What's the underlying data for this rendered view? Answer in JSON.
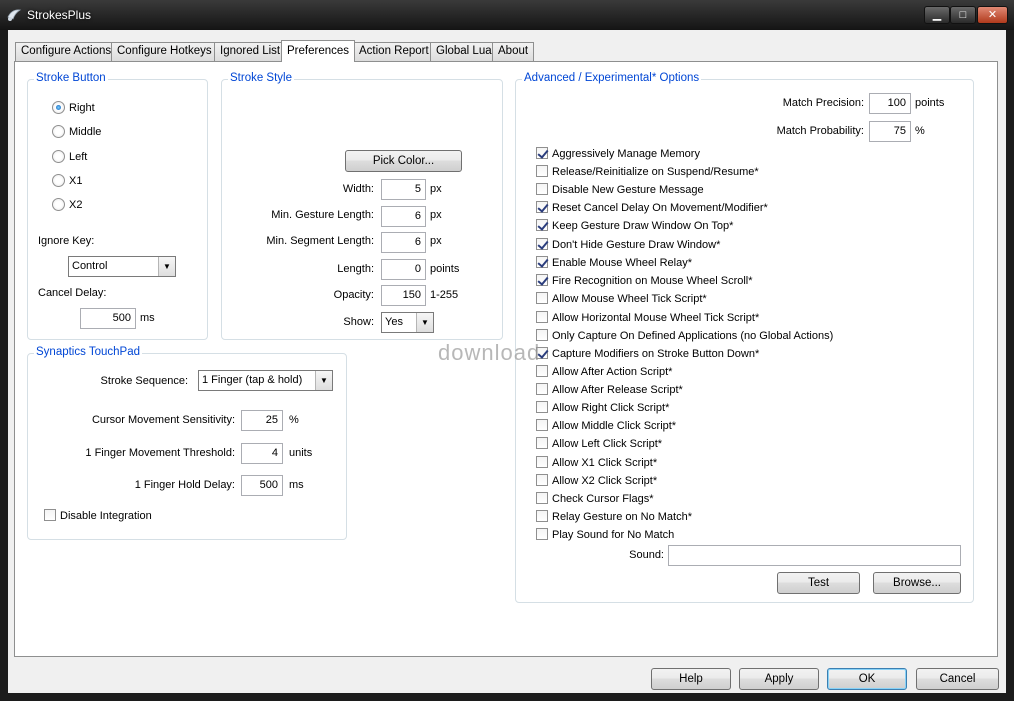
{
  "window": {
    "title": "StrokesPlus",
    "min_glyph": "▁",
    "max_glyph": "□",
    "close_glyph": "✕"
  },
  "tabs": [
    "Configure Actions",
    "Configure Hotkeys",
    "Ignored List",
    "Preferences",
    "Action Report",
    "Global Lua",
    "About"
  ],
  "stroke_button": {
    "title": "Stroke Button",
    "options": [
      "Right",
      "Middle",
      "Left",
      "X1",
      "X2"
    ],
    "selected": "Right",
    "ignore_key_label": "Ignore Key:",
    "ignore_key_value": "Control",
    "cancel_delay_label": "Cancel Delay:",
    "cancel_delay_value": "500",
    "cancel_delay_unit": "ms"
  },
  "stroke_style": {
    "title": "Stroke Style",
    "pick_color_label": "Pick Color...",
    "width_label": "Width:",
    "width_value": "5",
    "width_unit": "px",
    "min_gesture_label": "Min. Gesture Length:",
    "min_gesture_value": "6",
    "min_gesture_unit": "px",
    "min_segment_label": "Min. Segment Length:",
    "min_segment_value": "6",
    "min_segment_unit": "px",
    "length_label": "Length:",
    "length_value": "0",
    "length_unit": "points",
    "opacity_label": "Opacity:",
    "opacity_value": "150",
    "opacity_unit": "1-255",
    "show_label": "Show:",
    "show_value": "Yes"
  },
  "touchpad": {
    "title": "Synaptics TouchPad",
    "stroke_sequence_label": "Stroke Sequence:",
    "stroke_sequence_value": "1 Finger (tap & hold)",
    "sensitivity_label": "Cursor Movement Sensitivity:",
    "sensitivity_value": "25",
    "sensitivity_unit": "%",
    "threshold_label": "1 Finger Movement Threshold:",
    "threshold_value": "4",
    "threshold_unit": "units",
    "hold_delay_label": "1 Finger Hold Delay:",
    "hold_delay_value": "500",
    "hold_delay_unit": "ms",
    "disable_integration_label": "Disable Integration"
  },
  "advanced": {
    "title": "Advanced / Experimental* Options",
    "match_precision_label": "Match Precision:",
    "match_precision_value": "100",
    "match_precision_unit": "points",
    "match_probability_label": "Match Probability:",
    "match_probability_value": "75",
    "match_probability_unit": "%",
    "options": [
      {
        "label": "Aggressively Manage Memory",
        "checked": true
      },
      {
        "label": "Release/Reinitialize on Suspend/Resume*",
        "checked": false
      },
      {
        "label": "Disable New Gesture Message",
        "checked": false
      },
      {
        "label": "Reset Cancel Delay On Movement/Modifier*",
        "checked": true
      },
      {
        "label": "Keep Gesture Draw Window On Top*",
        "checked": true
      },
      {
        "label": "Don't Hide Gesture Draw Window*",
        "checked": true
      },
      {
        "label": "Enable Mouse Wheel Relay*",
        "checked": true
      },
      {
        "label": "Fire Recognition on Mouse Wheel Scroll*",
        "checked": true
      },
      {
        "label": "Allow Mouse Wheel Tick Script*",
        "checked": false
      },
      {
        "label": "Allow Horizontal Mouse Wheel Tick Script*",
        "checked": false
      },
      {
        "label": "Only Capture On Defined Applications (no Global Actions)",
        "checked": false
      },
      {
        "label": "Capture Modifiers on Stroke Button Down*",
        "checked": true
      },
      {
        "label": "Allow After Action Script*",
        "checked": false
      },
      {
        "label": "Allow After Release Script*",
        "checked": false
      },
      {
        "label": "Allow Right Click Script*",
        "checked": false
      },
      {
        "label": "Allow Middle Click Script*",
        "checked": false
      },
      {
        "label": "Allow Left Click Script*",
        "checked": false
      },
      {
        "label": "Allow X1 Click Script*",
        "checked": false
      },
      {
        "label": "Allow X2 Click Script*",
        "checked": false
      },
      {
        "label": "Check Cursor Flags*",
        "checked": false
      },
      {
        "label": "Relay Gesture on No Match*",
        "checked": false
      },
      {
        "label": "Play Sound for No Match",
        "checked": false
      }
    ],
    "sound_label": "Sound:",
    "sound_value": "",
    "test_label": "Test",
    "browse_label": "Browse..."
  },
  "footer": {
    "help": "Help",
    "apply": "Apply",
    "ok": "OK",
    "cancel": "Cancel"
  },
  "watermark": "download"
}
